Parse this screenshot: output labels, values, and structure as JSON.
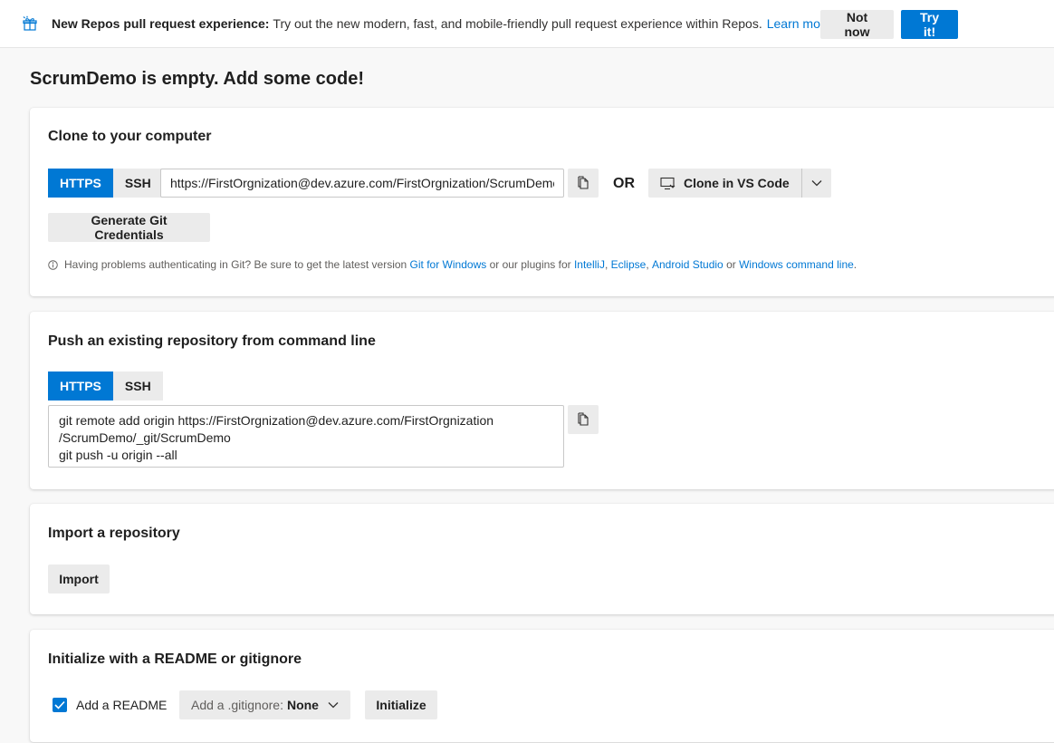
{
  "banner": {
    "icon": "gift-icon",
    "title": "New Repos pull request experience:",
    "text": "Try out the new modern, fast, and mobile-friendly pull request experience within Repos.",
    "learn_more": "Learn more",
    "not_now": "Not now",
    "try_it": "Try it!"
  },
  "page": {
    "title": "ScrumDemo is empty. Add some code!"
  },
  "clone": {
    "heading": "Clone to your computer",
    "https": "HTTPS",
    "ssh": "SSH",
    "url": "https://FirstOrgnization@dev.azure.com/FirstOrgnization/ScrumDemo/_git/ScrumDemo",
    "or": "OR",
    "clone_vscode": "Clone in VS Code",
    "generate_credentials": "Generate Git Credentials",
    "help": {
      "text1": "Having problems authenticating in Git? Be sure to get the latest version ",
      "git_for_windows": "Git for Windows",
      "text2": " or our plugins for ",
      "intellij": "IntelliJ",
      "comma1": ", ",
      "eclipse": "Eclipse",
      "comma2": ", ",
      "android_studio": "Android Studio",
      "text3": " or ",
      "windows_cmd": "Windows command line",
      "period": "."
    }
  },
  "push": {
    "heading": "Push an existing repository from command line",
    "https": "HTTPS",
    "ssh": "SSH",
    "lines": [
      "git remote add origin https://FirstOrgnization@dev.azure.com/FirstOrgnization",
      "/ScrumDemo/_git/ScrumDemo",
      "git push -u origin --all"
    ]
  },
  "import": {
    "heading": "Import a repository",
    "button": "Import"
  },
  "init": {
    "heading": "Initialize with a README or gitignore",
    "add_readme": "Add a README",
    "readme_checked": true,
    "gitignore_label": "Add a .gitignore:",
    "gitignore_value": "None",
    "initialize": "Initialize"
  },
  "colors": {
    "accent": "#0078d4",
    "button_bg": "#ebebeb",
    "page_bg": "#f8f8f8"
  }
}
